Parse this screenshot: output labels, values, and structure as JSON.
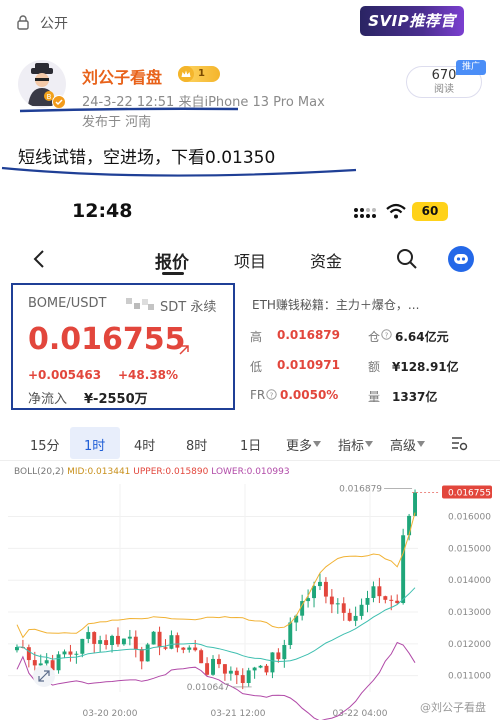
{
  "header": {
    "visibility_label": "公开",
    "svip_badge": "SVIP推荐官"
  },
  "author": {
    "name": "刘公子看盘",
    "level": "1",
    "post_meta": "24-3-22 12:51  来自iPhone 13 Pro Max",
    "location": "发布于 河南",
    "read_count": "670",
    "read_label": "阅读",
    "promo_tag": "推广"
  },
  "post": {
    "text": "短线试错，空进场，下看0.01350"
  },
  "phone": {
    "time": "12:48",
    "battery": "60"
  },
  "app_nav": {
    "tabs": [
      "报价",
      "项目",
      "资金"
    ],
    "active_tab": "报价"
  },
  "ticker": {
    "pair": "BOME/USDT",
    "pair_suffix": "SDT 永续",
    "price": "0.016755",
    "change_abs": "+0.005463",
    "change_pct": "+48.38%",
    "inflow_label": "净流入",
    "inflow_value": "¥-2550万",
    "notice": "ETH赚钱秘籍：主力＋爆仓，..."
  },
  "stats": [
    {
      "label": "高",
      "value": "0.016879",
      "tone": "red"
    },
    {
      "label": "仓",
      "value": "6.64亿元",
      "tone": "dark"
    },
    {
      "label": "低",
      "value": "0.010971",
      "tone": "red"
    },
    {
      "label": "额",
      "value": "¥128.91亿",
      "tone": "dark"
    },
    {
      "label": "FR",
      "value": "0.0050%",
      "tone": "red"
    },
    {
      "label": "量",
      "value": "1337亿",
      "tone": "dark"
    }
  ],
  "timeframes": [
    "15分",
    "1时",
    "4时",
    "8时",
    "1日",
    "更多",
    "指标",
    "高级"
  ],
  "active_timeframe": "1时",
  "indicator": {
    "name": "BOLL(20,2)",
    "mid": "MID:0.013441",
    "upper": "UPPER:0.015890",
    "lower": "LOWER:0.010993"
  },
  "chart_data": {
    "type": "candlestick",
    "y_ticks": [
      "0.016755",
      "0.016000",
      "0.015000",
      "0.014000",
      "0.013000",
      "0.012000",
      "0.011000"
    ],
    "x_ticks": [
      "03-20 20:00",
      "03-21 12:00",
      "03-22 04:00"
    ],
    "high_label": "0.016879",
    "low_label": "0.010647",
    "last_price": 0.016755,
    "colors": {
      "up": "#1fa67a",
      "down": "#e2463c",
      "mid": "#e0a530",
      "upper": "#f1b234",
      "lower": "#b14aa8"
    }
  },
  "watermark": "@刘公子看盘"
}
